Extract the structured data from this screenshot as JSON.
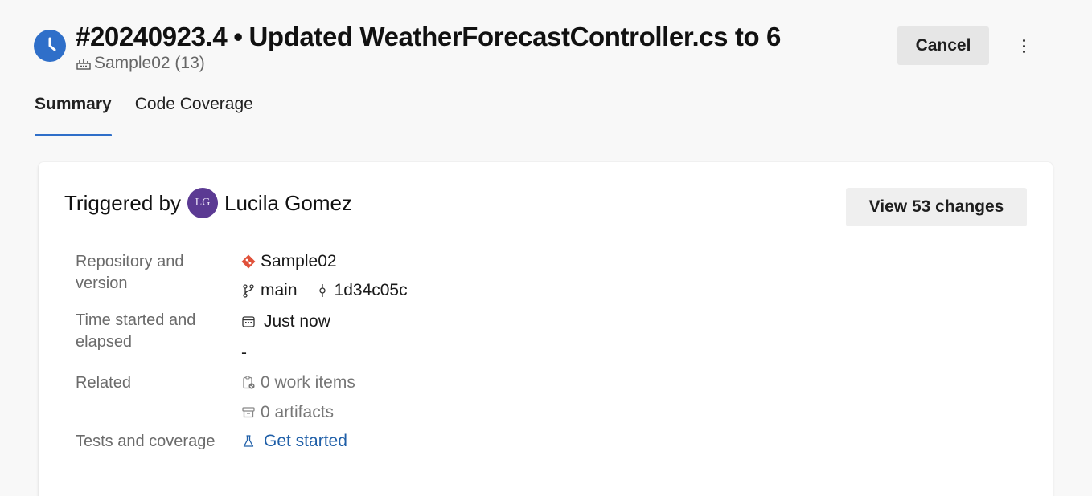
{
  "header": {
    "run_number": "#20240923.4",
    "separator": "•",
    "commit_message": "Updated WeatherForecastController.cs to 6",
    "pipeline": "Sample02 (13)",
    "cancel_label": "Cancel",
    "status_icon": "clock-icon",
    "more_icon": "more-vertical-icon"
  },
  "tabs": [
    {
      "label": "Summary",
      "active": true
    },
    {
      "label": "Code Coverage",
      "active": false
    }
  ],
  "summary": {
    "triggered_by_label": "Triggered by",
    "user_initials": "LG",
    "user_name": "Lucila Gomez",
    "view_changes_label": "View 53 changes",
    "repository": {
      "label": "Repository and version",
      "repo_name": "Sample02",
      "branch": "main",
      "commit": "1d34c05c"
    },
    "time": {
      "label": "Time started and elapsed",
      "started": "Just now",
      "elapsed": "-"
    },
    "related": {
      "label": "Related",
      "work_items": "0 work items",
      "artifacts": "0 artifacts"
    },
    "tests": {
      "label": "Tests and coverage",
      "link": "Get started"
    }
  },
  "colors": {
    "accent": "#2f6fc9",
    "avatar": "#5b3a93",
    "git_icon": "#e0513a",
    "link": "#1f5fa8"
  }
}
